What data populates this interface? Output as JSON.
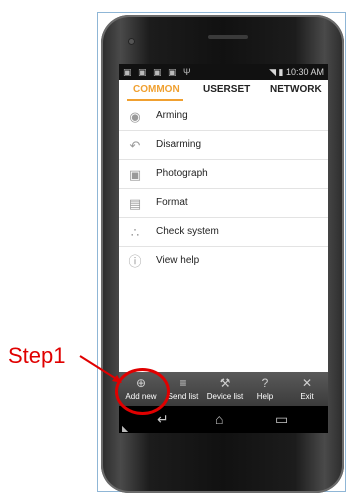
{
  "statusbar": {
    "left_icons": "▣ ▣ ▣ ▣ Ψ",
    "right_text": "◥ ▮ 10:30 AM"
  },
  "tabs": [
    {
      "label": "COMMON",
      "active": true
    },
    {
      "label": "USERSET",
      "active": false
    },
    {
      "label": "NETWORK",
      "active": false
    }
  ],
  "menu": [
    {
      "label": "Arming",
      "icon": "eye-icon"
    },
    {
      "label": "Disarming",
      "icon": "undo-icon"
    },
    {
      "label": "Photograph",
      "icon": "camera-icon"
    },
    {
      "label": "Format",
      "icon": "floppy-icon"
    },
    {
      "label": "Check system",
      "icon": "share-icon"
    },
    {
      "label": "View help",
      "icon": "info-icon"
    }
  ],
  "toolbar": [
    {
      "label": "Add new",
      "icon": "plus-circle-icon"
    },
    {
      "label": "Send list",
      "icon": "list-icon"
    },
    {
      "label": "Device list",
      "icon": "wrench-icon"
    },
    {
      "label": "Help",
      "icon": "question-icon"
    },
    {
      "label": "Exit",
      "icon": "close-icon"
    }
  ],
  "annotation": {
    "label": "Step1",
    "color": "#e00000"
  },
  "accent_color": "#f0a030"
}
